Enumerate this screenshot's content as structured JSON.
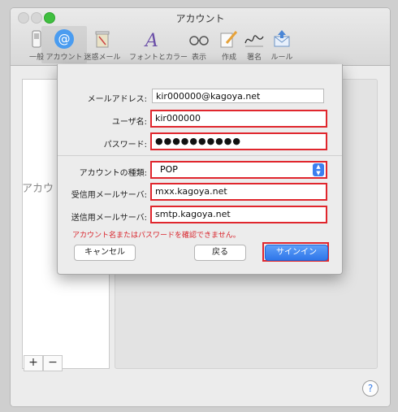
{
  "window": {
    "title": "アカウント"
  },
  "toolbar": {
    "items": [
      {
        "label": "一般",
        "icon": "switch-icon"
      },
      {
        "label": "アカウント",
        "icon": "at-sign-icon"
      },
      {
        "label": "迷惑メール",
        "icon": "trash-can-icon"
      },
      {
        "label": "フォントとカラー",
        "icon": "font-color-icon"
      },
      {
        "label": "表示",
        "icon": "glasses-icon"
      },
      {
        "label": "作成",
        "icon": "pencil-icon"
      },
      {
        "label": "署名",
        "icon": "signature-icon"
      },
      {
        "label": "ルール",
        "icon": "envelope-rule-icon"
      }
    ],
    "selected_index": 1
  },
  "sidebar": {
    "stub_text": "アカウ",
    "add_label": "+",
    "remove_label": "−"
  },
  "sheet": {
    "email_label": "メールアドレス:",
    "email_value": "kir000000@kagoya.net",
    "username_label": "ユーザ名:",
    "username_value": "kir000000",
    "password_label": "パスワード:",
    "password_value": "●●●●●●●●●●",
    "account_type_label": "アカウントの種類:",
    "account_type_value": "POP",
    "incoming_label": "受信用メールサーバ:",
    "incoming_value": "mxx.kagoya.net",
    "outgoing_label": "送信用メールサーバ:",
    "outgoing_value": "smtp.kagoya.net",
    "error_message": "アカウント名またはパスワードを確認できません。",
    "cancel_label": "キャンセル",
    "back_label": "戻る",
    "signin_label": "サインイン"
  },
  "help": {
    "label": "?"
  },
  "colors": {
    "accent": "#3b7ff0",
    "highlight": "#e0262d"
  }
}
